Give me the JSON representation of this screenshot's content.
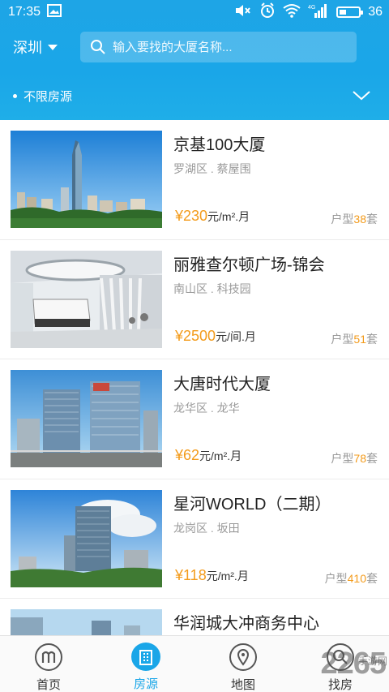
{
  "status_bar": {
    "time": "17:35",
    "network": "4G",
    "battery": "36",
    "battery_level": 0.36
  },
  "header": {
    "city": "深圳",
    "search_placeholder": "输入要找的大厦名称...",
    "filter_label": "不限房源"
  },
  "listings": [
    {
      "name": "京基100大厦",
      "location": "罗湖区 . 蔡屋围",
      "price": "¥230",
      "unit": "元/m².月",
      "rooms_label": "户型",
      "rooms": "38",
      "rooms_suffix": "套"
    },
    {
      "name": "丽雅查尔顿广场-锦会",
      "location": "南山区 . 科技园",
      "price": "¥2500",
      "unit": "元/间.月",
      "rooms_label": "户型",
      "rooms": "51",
      "rooms_suffix": "套"
    },
    {
      "name": "大唐时代大厦",
      "location": "龙华区 . 龙华",
      "price": "¥62",
      "unit": "元/m².月",
      "rooms_label": "户型",
      "rooms": "78",
      "rooms_suffix": "套"
    },
    {
      "name": "星河WORLD（二期）",
      "location": "龙岗区 . 坂田",
      "price": "¥118",
      "unit": "元/m².月",
      "rooms_label": "户型",
      "rooms": "410",
      "rooms_suffix": "套"
    },
    {
      "name": "华润城大冲商务中心",
      "location": "",
      "price": "",
      "unit": "",
      "rooms_label": "",
      "rooms": "",
      "rooms_suffix": ""
    }
  ],
  "tabs": [
    {
      "label": "首页",
      "icon": "home-m-icon"
    },
    {
      "label": "房源",
      "icon": "building-icon",
      "active": true
    },
    {
      "label": "地图",
      "icon": "map-pin-icon"
    },
    {
      "label": "找房",
      "icon": "find-icon"
    }
  ],
  "watermark": {
    "text": "2265",
    "sub": "手游网"
  },
  "colors": {
    "primary": "#1aa6e8",
    "price": "#f39b1b"
  }
}
